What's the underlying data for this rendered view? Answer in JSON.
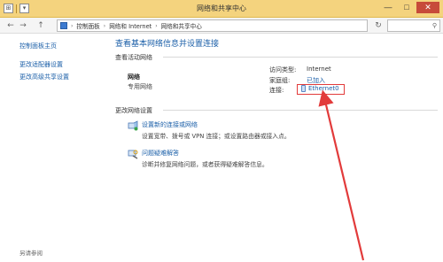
{
  "window": {
    "title": "网络和共享中心",
    "controls": {
      "minimize": "—",
      "maximize": "□",
      "close": "✕"
    }
  },
  "addressbar": {
    "back": "←",
    "forward": "→",
    "up": "↑",
    "breadcrumbs": [
      "控制面板",
      "网络和 Internet",
      "网络和共享中心"
    ],
    "separator": "›",
    "refresh": "↻",
    "search_glyph": "⚲"
  },
  "sidebar": {
    "items": [
      {
        "label": "控制面板主页"
      },
      {
        "label": "更改适配器设置"
      },
      {
        "label": "更改高级共享设置"
      }
    ],
    "see_also": "另请参阅"
  },
  "main": {
    "heading": "查看基本网络信息并设置连接",
    "active_networks": {
      "section_title": "查看活动网络",
      "network_name": "网络",
      "network_type": "专用网络",
      "access_type_label": "访问类型:",
      "access_type_value": "Internet",
      "homegroup_label": "家庭组:",
      "homegroup_value": "已加入",
      "connections_label": "连接:",
      "connections_value": "Ethernet0"
    },
    "change_settings": {
      "section_title": "更改网络设置",
      "tasks": [
        {
          "title": "设置新的连接或网络",
          "desc": "设置宽带、拨号或 VPN 连接；或设置路由器或接入点。"
        },
        {
          "title": "问题疑难解答",
          "desc": "诊断并修复网络问题，或者获得疑难解答信息。"
        }
      ]
    }
  },
  "colors": {
    "titlebar": "#f4d37e",
    "link": "#1b5fa8",
    "annotation": "#e23b3b"
  }
}
